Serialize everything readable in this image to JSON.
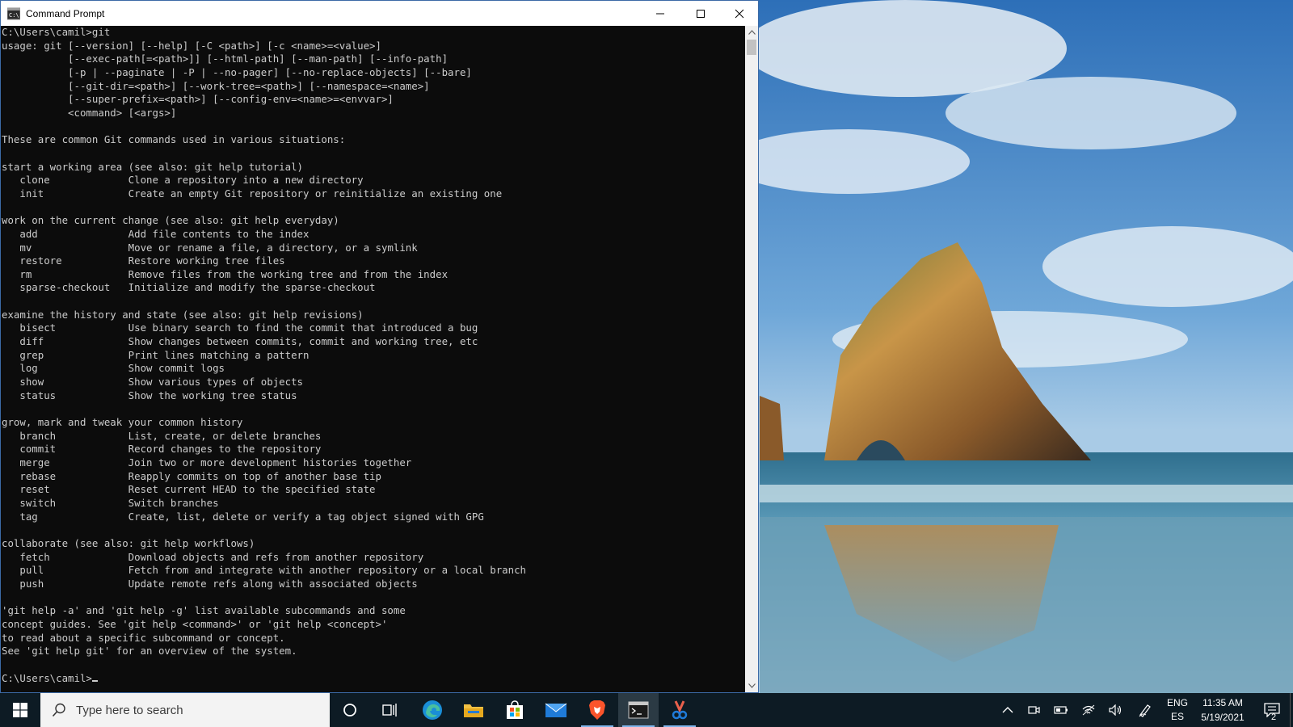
{
  "window": {
    "title": "Command Prompt",
    "minimize_label": "Minimize",
    "maximize_label": "Maximize",
    "close_label": "Close"
  },
  "console": {
    "lines": [
      "C:\\Users\\camil>git",
      "usage: git [--version] [--help] [-C <path>] [-c <name>=<value>]",
      "           [--exec-path[=<path>]] [--html-path] [--man-path] [--info-path]",
      "           [-p | --paginate | -P | --no-pager] [--no-replace-objects] [--bare]",
      "           [--git-dir=<path>] [--work-tree=<path>] [--namespace=<name>]",
      "           [--super-prefix=<path>] [--config-env=<name>=<envvar>]",
      "           <command> [<args>]",
      "",
      "These are common Git commands used in various situations:",
      "",
      "start a working area (see also: git help tutorial)",
      "   clone             Clone a repository into a new directory",
      "   init              Create an empty Git repository or reinitialize an existing one",
      "",
      "work on the current change (see also: git help everyday)",
      "   add               Add file contents to the index",
      "   mv                Move or rename a file, a directory, or a symlink",
      "   restore           Restore working tree files",
      "   rm                Remove files from the working tree and from the index",
      "   sparse-checkout   Initialize and modify the sparse-checkout",
      "",
      "examine the history and state (see also: git help revisions)",
      "   bisect            Use binary search to find the commit that introduced a bug",
      "   diff              Show changes between commits, commit and working tree, etc",
      "   grep              Print lines matching a pattern",
      "   log               Show commit logs",
      "   show              Show various types of objects",
      "   status            Show the working tree status",
      "",
      "grow, mark and tweak your common history",
      "   branch            List, create, or delete branches",
      "   commit            Record changes to the repository",
      "   merge             Join two or more development histories together",
      "   rebase            Reapply commits on top of another base tip",
      "   reset             Reset current HEAD to the specified state",
      "   switch            Switch branches",
      "   tag               Create, list, delete or verify a tag object signed with GPG",
      "",
      "collaborate (see also: git help workflows)",
      "   fetch             Download objects and refs from another repository",
      "   pull              Fetch from and integrate with another repository or a local branch",
      "   push              Update remote refs along with associated objects",
      "",
      "'git help -a' and 'git help -g' list available subcommands and some",
      "concept guides. See 'git help <command>' or 'git help <concept>'",
      "to read about a specific subcommand or concept.",
      "See 'git help git' for an overview of the system.",
      ""
    ],
    "prompt": "C:\\Users\\camil>"
  },
  "taskbar": {
    "search_placeholder": "Type here to search",
    "apps": [
      {
        "name": "cortana",
        "icon": "circle-icon"
      },
      {
        "name": "task-view",
        "icon": "task-view-icon"
      },
      {
        "name": "edge",
        "icon": "edge-icon"
      },
      {
        "name": "file-explorer",
        "icon": "folder-icon"
      },
      {
        "name": "store",
        "icon": "store-icon"
      },
      {
        "name": "mail",
        "icon": "mail-icon"
      },
      {
        "name": "brave",
        "icon": "brave-icon"
      },
      {
        "name": "command-prompt",
        "icon": "terminal-icon"
      },
      {
        "name": "snip-sketch",
        "icon": "snip-icon"
      }
    ],
    "language_top": "ENG",
    "language_bottom": "ES",
    "time": "11:35 AM",
    "date": "5/19/2021",
    "notification_count": "2"
  },
  "colors": {
    "console_bg": "#0c0c0c",
    "console_fg": "#cccccc",
    "taskbar_bg": "#0d1b24",
    "accent": "#7eb4ea"
  }
}
